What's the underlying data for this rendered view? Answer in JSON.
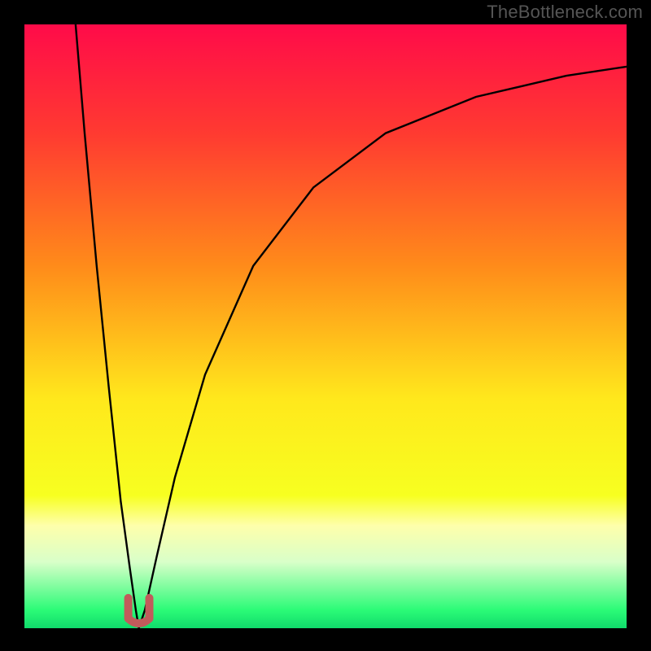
{
  "watermark": "TheBottleneck.com",
  "colors": {
    "frame": "#000000",
    "watermark": "#555555",
    "curve": "#000000",
    "marker": "#c15b5b",
    "gradient_stops": [
      {
        "offset": 0.0,
        "color": "#ff0b49"
      },
      {
        "offset": 0.18,
        "color": "#ff3a31"
      },
      {
        "offset": 0.4,
        "color": "#ff8b1a"
      },
      {
        "offset": 0.62,
        "color": "#ffe81c"
      },
      {
        "offset": 0.78,
        "color": "#f7ff20"
      },
      {
        "offset": 0.83,
        "color": "#feffab"
      },
      {
        "offset": 0.89,
        "color": "#d9ffc9"
      },
      {
        "offset": 0.97,
        "color": "#2bfb77"
      },
      {
        "offset": 1.0,
        "color": "#10db6b"
      }
    ]
  },
  "chart_data": {
    "type": "line",
    "title": "",
    "xlabel": "",
    "ylabel": "",
    "xlim": [
      0,
      100
    ],
    "ylim": [
      0,
      100
    ],
    "x_optimum": 19,
    "series": [
      {
        "name": "left-branch",
        "x": [
          8.5,
          10,
          12,
          14,
          16,
          17.5,
          18.5,
          19
        ],
        "y": [
          100,
          82,
          60,
          40,
          21,
          10,
          3,
          0
        ]
      },
      {
        "name": "right-branch",
        "x": [
          19,
          20,
          22,
          25,
          30,
          38,
          48,
          60,
          75,
          90,
          100
        ],
        "y": [
          0,
          3,
          12,
          25,
          42,
          60,
          73,
          82,
          88,
          91.5,
          93
        ]
      }
    ],
    "marker": {
      "shape": "u",
      "x_center": 19,
      "y_base": 0,
      "width": 3.5,
      "height": 5
    }
  }
}
